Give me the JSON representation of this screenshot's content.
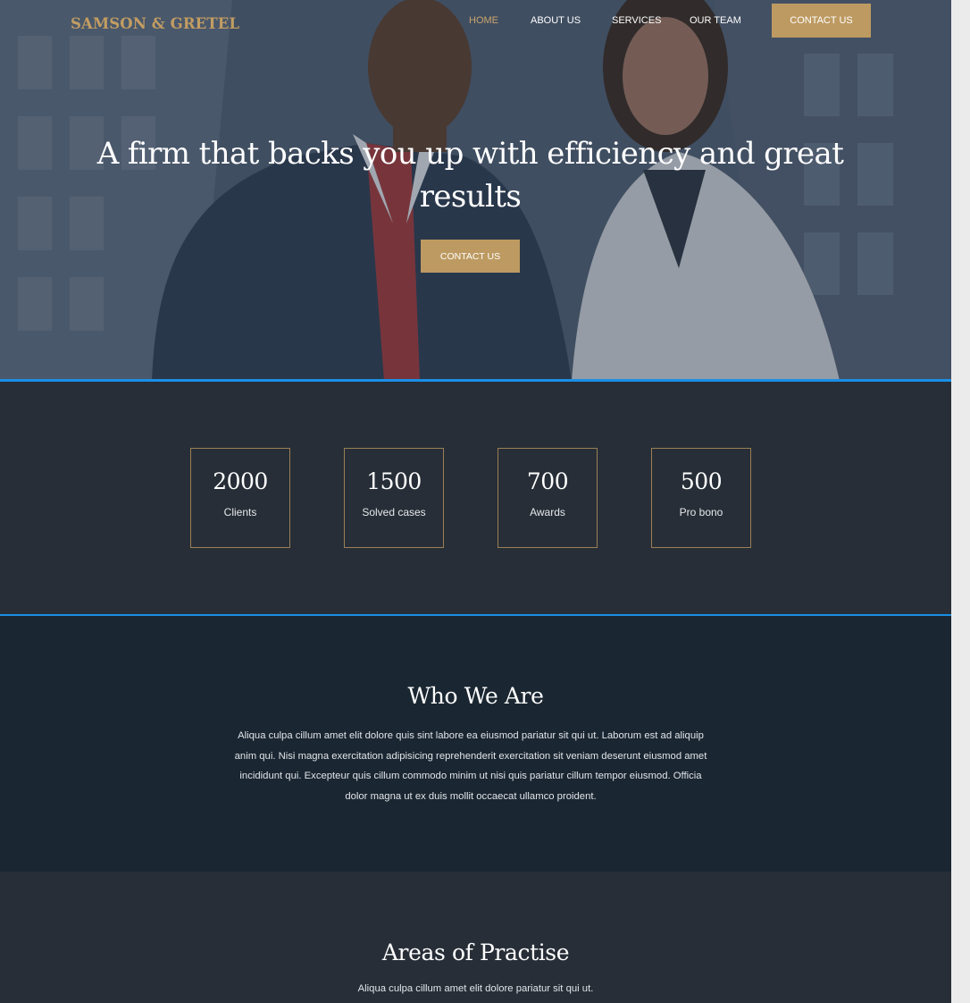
{
  "brand": {
    "logo": "SAMSON & GRETEL",
    "accent_color": "#bd9a61",
    "outline_color": "#1a8fe6"
  },
  "nav": {
    "items": [
      {
        "label": "HOME",
        "active": true
      },
      {
        "label": "ABOUT US",
        "active": false
      },
      {
        "label": "SERVICES",
        "active": false
      },
      {
        "label": "OUR TEAM",
        "active": false
      }
    ],
    "cta_label": "CONTACT US"
  },
  "hero": {
    "title": "A firm that backs you up with efficiency and great results",
    "cta_label": "CONTACT US"
  },
  "stats": [
    {
      "value": "2000",
      "label": "Clients"
    },
    {
      "value": "1500",
      "label": "Solved cases"
    },
    {
      "value": "700",
      "label": "Awards"
    },
    {
      "value": "500",
      "label": "Pro bono"
    }
  ],
  "who_we_are": {
    "title": "Who We Are",
    "body": "Aliqua culpa cillum amet elit dolore quis sint labore ea eiusmod pariatur sit qui ut. Laborum est ad aliquip anim qui. Nisi magna exercitation adipisicing reprehenderit exercitation sit veniam deserunt eiusmod amet incididunt qui. Excepteur quis cillum commodo minim ut nisi quis pariatur cillum tempor eiusmod. Officia dolor magna ut ex duis mollit occaecat ullamco proident."
  },
  "areas": {
    "title": "Areas of Practise",
    "subtitle": "Aliqua culpa cillum amet elit dolore pariatur sit qui ut."
  }
}
